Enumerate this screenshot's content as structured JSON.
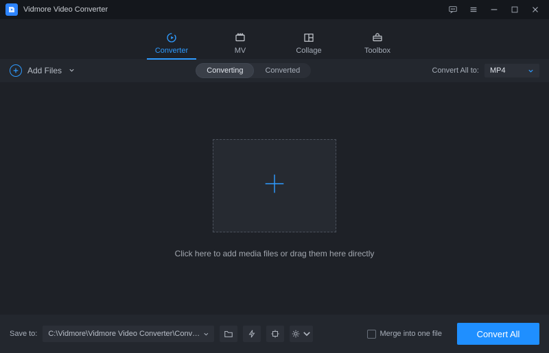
{
  "app": {
    "title": "Vidmore Video Converter"
  },
  "tabs": [
    {
      "label": "Converter"
    },
    {
      "label": "MV"
    },
    {
      "label": "Collage"
    },
    {
      "label": "Toolbox"
    }
  ],
  "actionbar": {
    "add_files_label": "Add Files",
    "segments": {
      "converting": "Converting",
      "converted": "Converted"
    },
    "convert_all_to_label": "Convert All to:",
    "selected_format": "MP4"
  },
  "drop": {
    "hint": "Click here to add media files or drag them here directly"
  },
  "bottom": {
    "save_to_label": "Save to:",
    "save_path": "C:\\Vidmore\\Vidmore Video Converter\\Converted",
    "merge_label": "Merge into one file",
    "convert_all_btn": "Convert All"
  }
}
